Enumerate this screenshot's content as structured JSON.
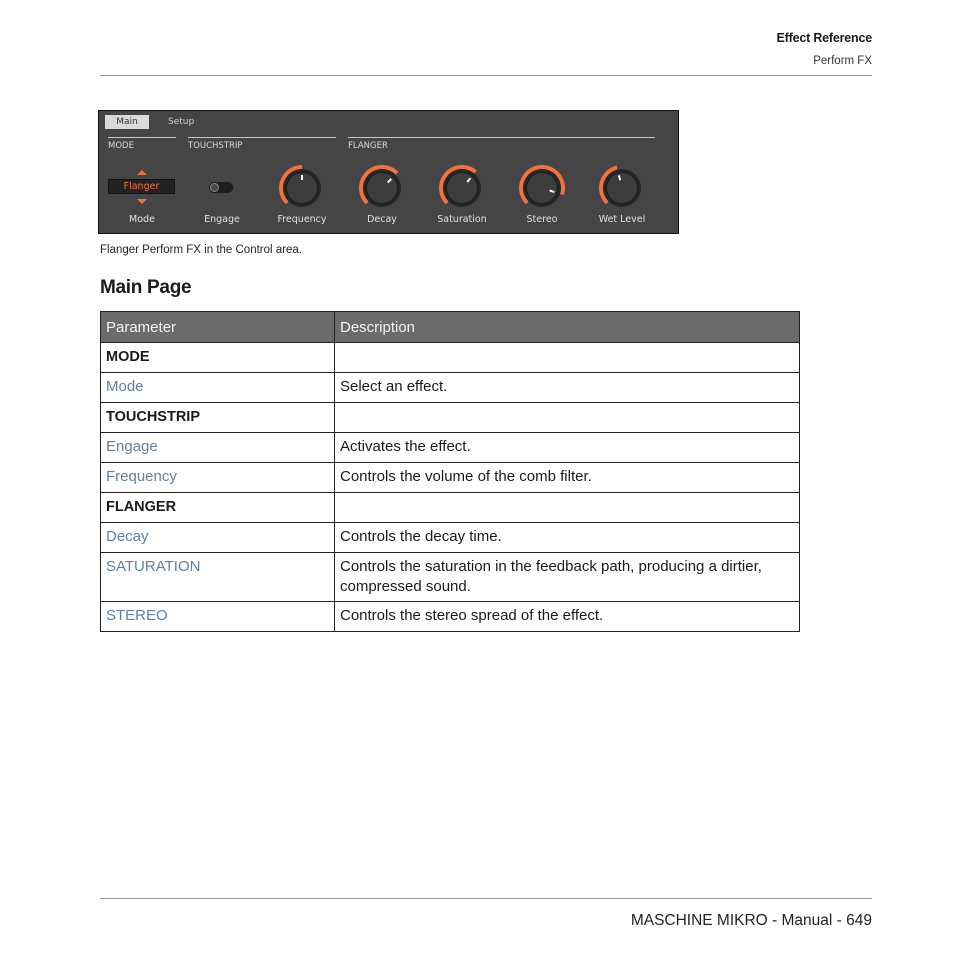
{
  "header": {
    "chapter": "Effect Reference",
    "section": "Perform FX"
  },
  "panel": {
    "tabs": [
      {
        "label": "Main",
        "active": true
      },
      {
        "label": "Setup",
        "active": false
      }
    ],
    "sections": [
      "MODE",
      "TOUCHSTRIP",
      "FLANGER"
    ],
    "mode": {
      "value": "Flanger",
      "label": "Mode"
    },
    "engage": {
      "label": "Engage",
      "on": false
    },
    "knobs": [
      {
        "label": "Frequency",
        "value": 0.5
      },
      {
        "label": "Decay",
        "value": 0.67
      },
      {
        "label": "Saturation",
        "value": 0.65
      },
      {
        "label": "Stereo",
        "value": 0.9
      },
      {
        "label": "Wet Level",
        "value": 0.45
      }
    ],
    "accent": "#f2713a"
  },
  "caption": "Flanger Perform FX in the Control area.",
  "heading": "Main Page",
  "table": {
    "headers": [
      "Parameter",
      "Description"
    ],
    "rows": [
      {
        "param": "MODE",
        "desc": "",
        "type": "section"
      },
      {
        "param": "Mode",
        "desc": "Select an effect.",
        "type": "link"
      },
      {
        "param": "TOUCHSTRIP",
        "desc": "",
        "type": "section"
      },
      {
        "param": "Engage",
        "desc": "Activates the effect.",
        "type": "link"
      },
      {
        "param": "Frequency",
        "desc": "Controls the volume of the comb filter.",
        "type": "link"
      },
      {
        "param": "FLANGER",
        "desc": "",
        "type": "section"
      },
      {
        "param": "Decay",
        "desc": "Controls the decay time.",
        "type": "link"
      },
      {
        "param": "SATURATION",
        "desc": "Controls the saturation in the feedback path, producing a dirtier, compressed sound.",
        "type": "link"
      },
      {
        "param": "STEREO",
        "desc": "Controls the stereo spread of the effect.",
        "type": "link"
      }
    ]
  },
  "footer": {
    "text": "MASCHINE MIKRO - Manual - 649"
  }
}
